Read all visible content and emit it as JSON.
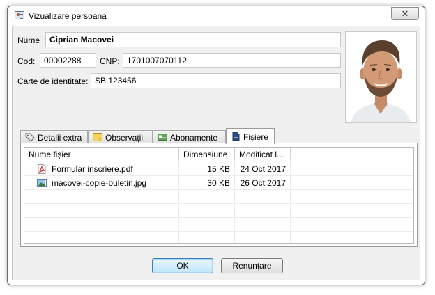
{
  "window": {
    "title": "Vizualizare persoana",
    "close_label": "✕"
  },
  "person": {
    "name_label": "Nume",
    "name_value": "Ciprian Macovei",
    "code_label": "Cod:",
    "code_value": "00002288",
    "cnp_label": "CNP:",
    "cnp_value": "1701007070112",
    "id_card_label": "Carte de identitate:",
    "id_card_value": "SB 123456"
  },
  "tabs": [
    {
      "label": "Detalii extra",
      "icon": "tag-icon",
      "active": false
    },
    {
      "label": "Observații",
      "icon": "note-icon",
      "active": false
    },
    {
      "label": "Abonamente",
      "icon": "card-icon",
      "active": false
    },
    {
      "label": "Fișiere",
      "icon": "document-icon",
      "active": true
    }
  ],
  "files": {
    "columns": [
      "Nume fișier",
      "Dimensiune",
      "Modificat l..."
    ],
    "rows": [
      {
        "name": "Formular inscriere.pdf",
        "size": "15 KB",
        "modified": "24 Oct 2017",
        "icon": "pdf-icon"
      },
      {
        "name": "macovei-copie-buletin.jpg",
        "size": "30 KB",
        "modified": "26 Oct 2017",
        "icon": "image-icon"
      }
    ]
  },
  "buttons": {
    "ok_label": "OK",
    "cancel_label": "Renunțare"
  },
  "colors": {
    "accent": "#3c7fb1",
    "pdf_red": "#d0302f",
    "tab_active_bg": "#ffffff"
  }
}
